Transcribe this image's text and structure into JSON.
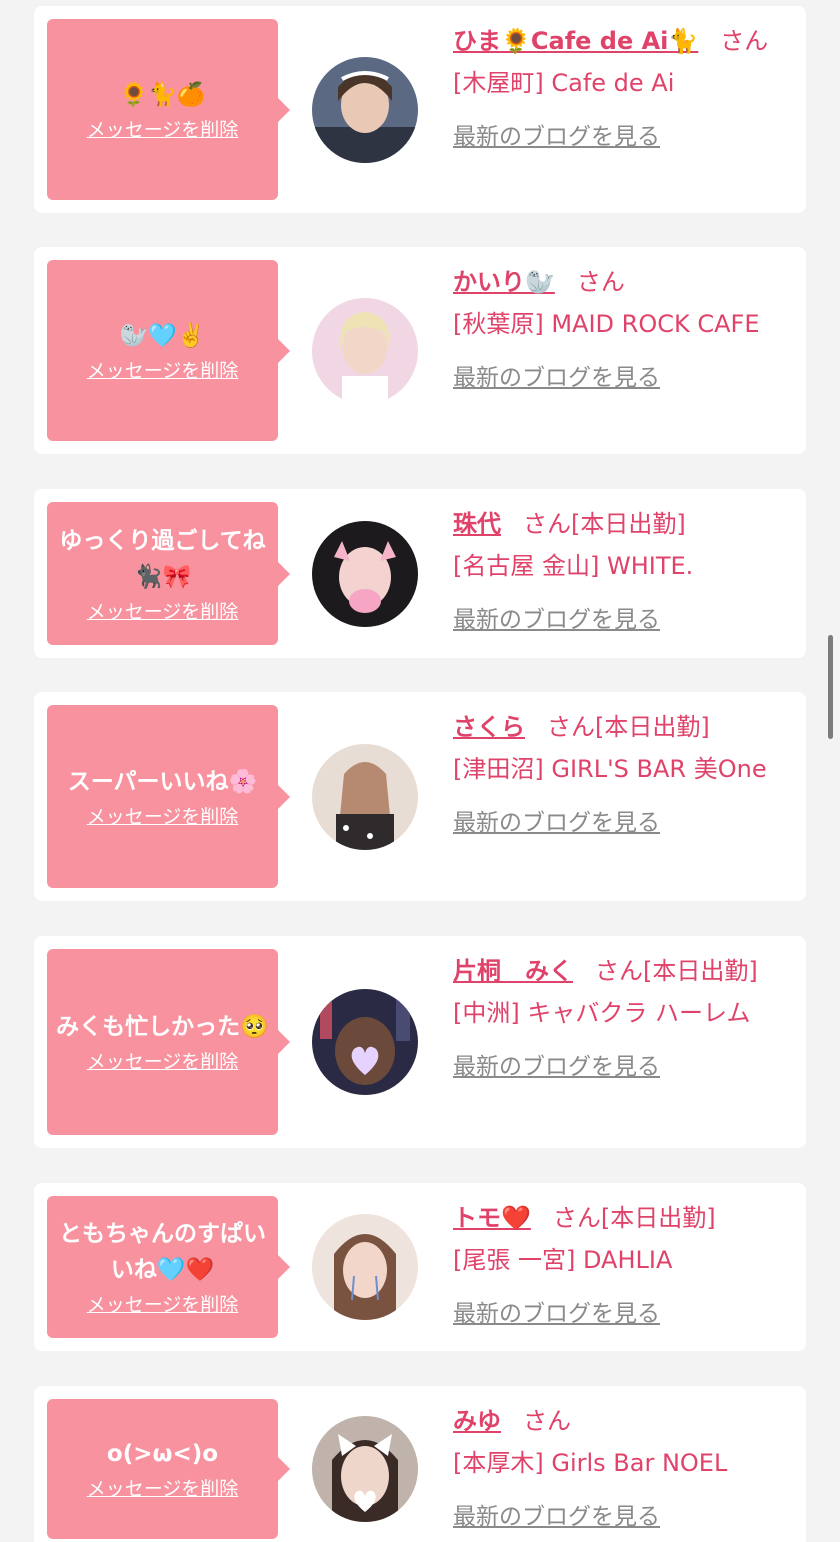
{
  "colors": {
    "accent": "#e0436a",
    "bubble": "#f8929f",
    "card": "#ffffff",
    "background": "#f3f3f3",
    "link_gray": "#8a8a8a"
  },
  "labels": {
    "delete_message": "メッセージを削除",
    "latest_blog": "最新のブログを見る",
    "honorific": "さん",
    "today_attendance": "[本日出勤]"
  },
  "messages": [
    {
      "message": "🌻🐈🍊",
      "name": "ひま🌻Cafe de Ai🐈",
      "status": "",
      "shop": "[木屋町] Cafe de Ai"
    },
    {
      "message": "🦭🩵✌️",
      "name": "かいり🦭",
      "status": "",
      "shop": "[秋葉原] MAID ROCK CAFE"
    },
    {
      "message": "ゆっくり過ごしてね🐈‍⬛🎀",
      "name": "珠代",
      "status": "[本日出勤]",
      "shop": "[名古屋 金山] WHITE."
    },
    {
      "message": "スーパーいいね🌸",
      "name": "さくら",
      "status": "[本日出勤]",
      "shop": "[津田沼] GIRL'S BAR 美One"
    },
    {
      "message": "みくも忙しかった🥺",
      "name": "片桐　みく",
      "status": "[本日出勤]",
      "shop": "[中洲] キャバクラ ハーレム"
    },
    {
      "message": "ともちゃんのすぱいいね🩵❤️",
      "name": "トモ❤️",
      "status": "[本日出勤]",
      "shop": "[尾張 一宮] DAHLIA"
    },
    {
      "message": "o(>ω<)o",
      "name": "みゆ",
      "status": "",
      "shop": "[本厚木] Girls Bar NOEL"
    }
  ]
}
